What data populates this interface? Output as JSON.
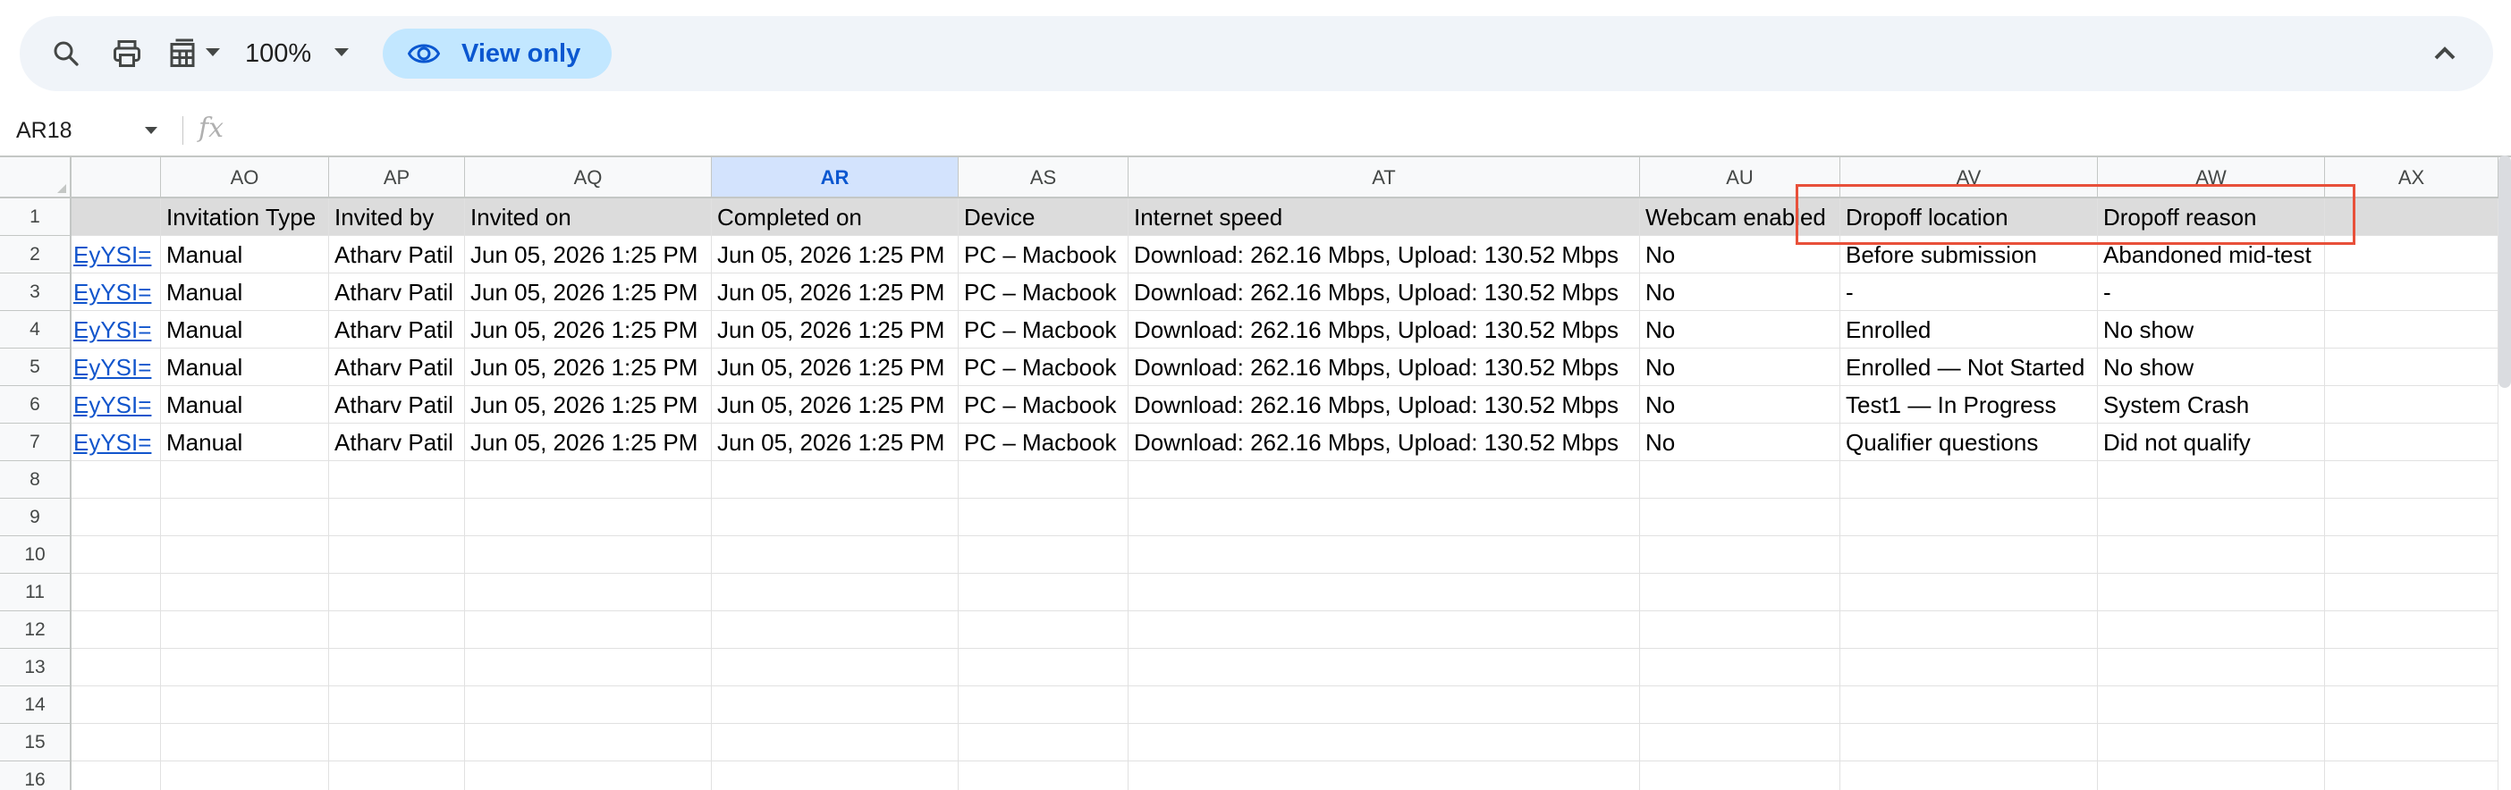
{
  "toolbar": {
    "zoom": "100%",
    "view_only_label": "View only",
    "icons": [
      "search-icon",
      "print-icon",
      "format-table-icon",
      "zoom-caret-icon",
      "eye-icon",
      "chevron-up-icon"
    ]
  },
  "formula_bar": {
    "name_box": "AR18",
    "fx_label": "fx",
    "value": ""
  },
  "grid": {
    "selected_column": "AR",
    "columns": [
      "",
      "AO",
      "AP",
      "AQ",
      "AR",
      "AS",
      "AT",
      "AU",
      "AV",
      "AW",
      "AX"
    ],
    "row_numbers": [
      "1",
      "2",
      "3",
      "4",
      "5",
      "6",
      "7",
      "8",
      "9",
      "10",
      "11",
      "12",
      "13",
      "14",
      "15",
      "16"
    ],
    "rows": [
      [
        "",
        "Invitation Type",
        "Invited by",
        "Invited on",
        "Completed on",
        "Device",
        "Internet speed",
        "Webcam enabled",
        "Dropoff location",
        "Dropoff reason",
        ""
      ],
      [
        "EyYSI=",
        "Manual",
        "Atharv Patil",
        "Jun 05, 2026 1:25 PM",
        "Jun 05, 2026 1:25 PM",
        "PC – Macbook",
        "Download: 262.16 Mbps, Upload: 130.52 Mbps",
        "No",
        "Before submission",
        "Abandoned mid-test",
        ""
      ],
      [
        "EyYSI=",
        "Manual",
        "Atharv Patil",
        "Jun 05, 2026 1:25 PM",
        "Jun 05, 2026 1:25 PM",
        "PC – Macbook",
        "Download: 262.16 Mbps, Upload: 130.52 Mbps",
        "No",
        "-",
        "-",
        ""
      ],
      [
        "EyYSI=",
        "Manual",
        "Atharv Patil",
        "Jun 05, 2026 1:25 PM",
        "Jun 05, 2026 1:25 PM",
        "PC – Macbook",
        "Download: 262.16 Mbps, Upload: 130.52 Mbps",
        "No",
        "Enrolled",
        "No show",
        ""
      ],
      [
        "EyYSI=",
        "Manual",
        "Atharv Patil",
        "Jun 05, 2026 1:25 PM",
        "Jun 05, 2026 1:25 PM",
        "PC – Macbook",
        "Download: 262.16 Mbps, Upload: 130.52 Mbps",
        "No",
        "Enrolled — Not Started",
        "No show",
        ""
      ],
      [
        "EyYSI=",
        "Manual",
        "Atharv Patil",
        "Jun 05, 2026 1:25 PM",
        "Jun 05, 2026 1:25 PM",
        "PC – Macbook",
        "Download: 262.16 Mbps, Upload: 130.52 Mbps",
        "No",
        "Test1 — In Progress",
        "System Crash",
        ""
      ],
      [
        "EyYSI=",
        "Manual",
        "Atharv Patil",
        "Jun 05, 2026 1:25 PM",
        "Jun 05, 2026 1:25 PM",
        "PC – Macbook",
        "Download: 262.16 Mbps, Upload: 130.52 Mbps",
        "No",
        "Qualifier questions",
        "Did not qualify",
        ""
      ]
    ]
  },
  "colors": {
    "toolbar_bg": "#f0f4f9",
    "view_only_bg": "#c2e7ff",
    "view_only_text": "#0b57d0",
    "selected_col_bg": "#d3e3fd",
    "header_row_bg": "#dcdcdc",
    "link": "#1155cc",
    "annotation_box": "#e8503a"
  }
}
